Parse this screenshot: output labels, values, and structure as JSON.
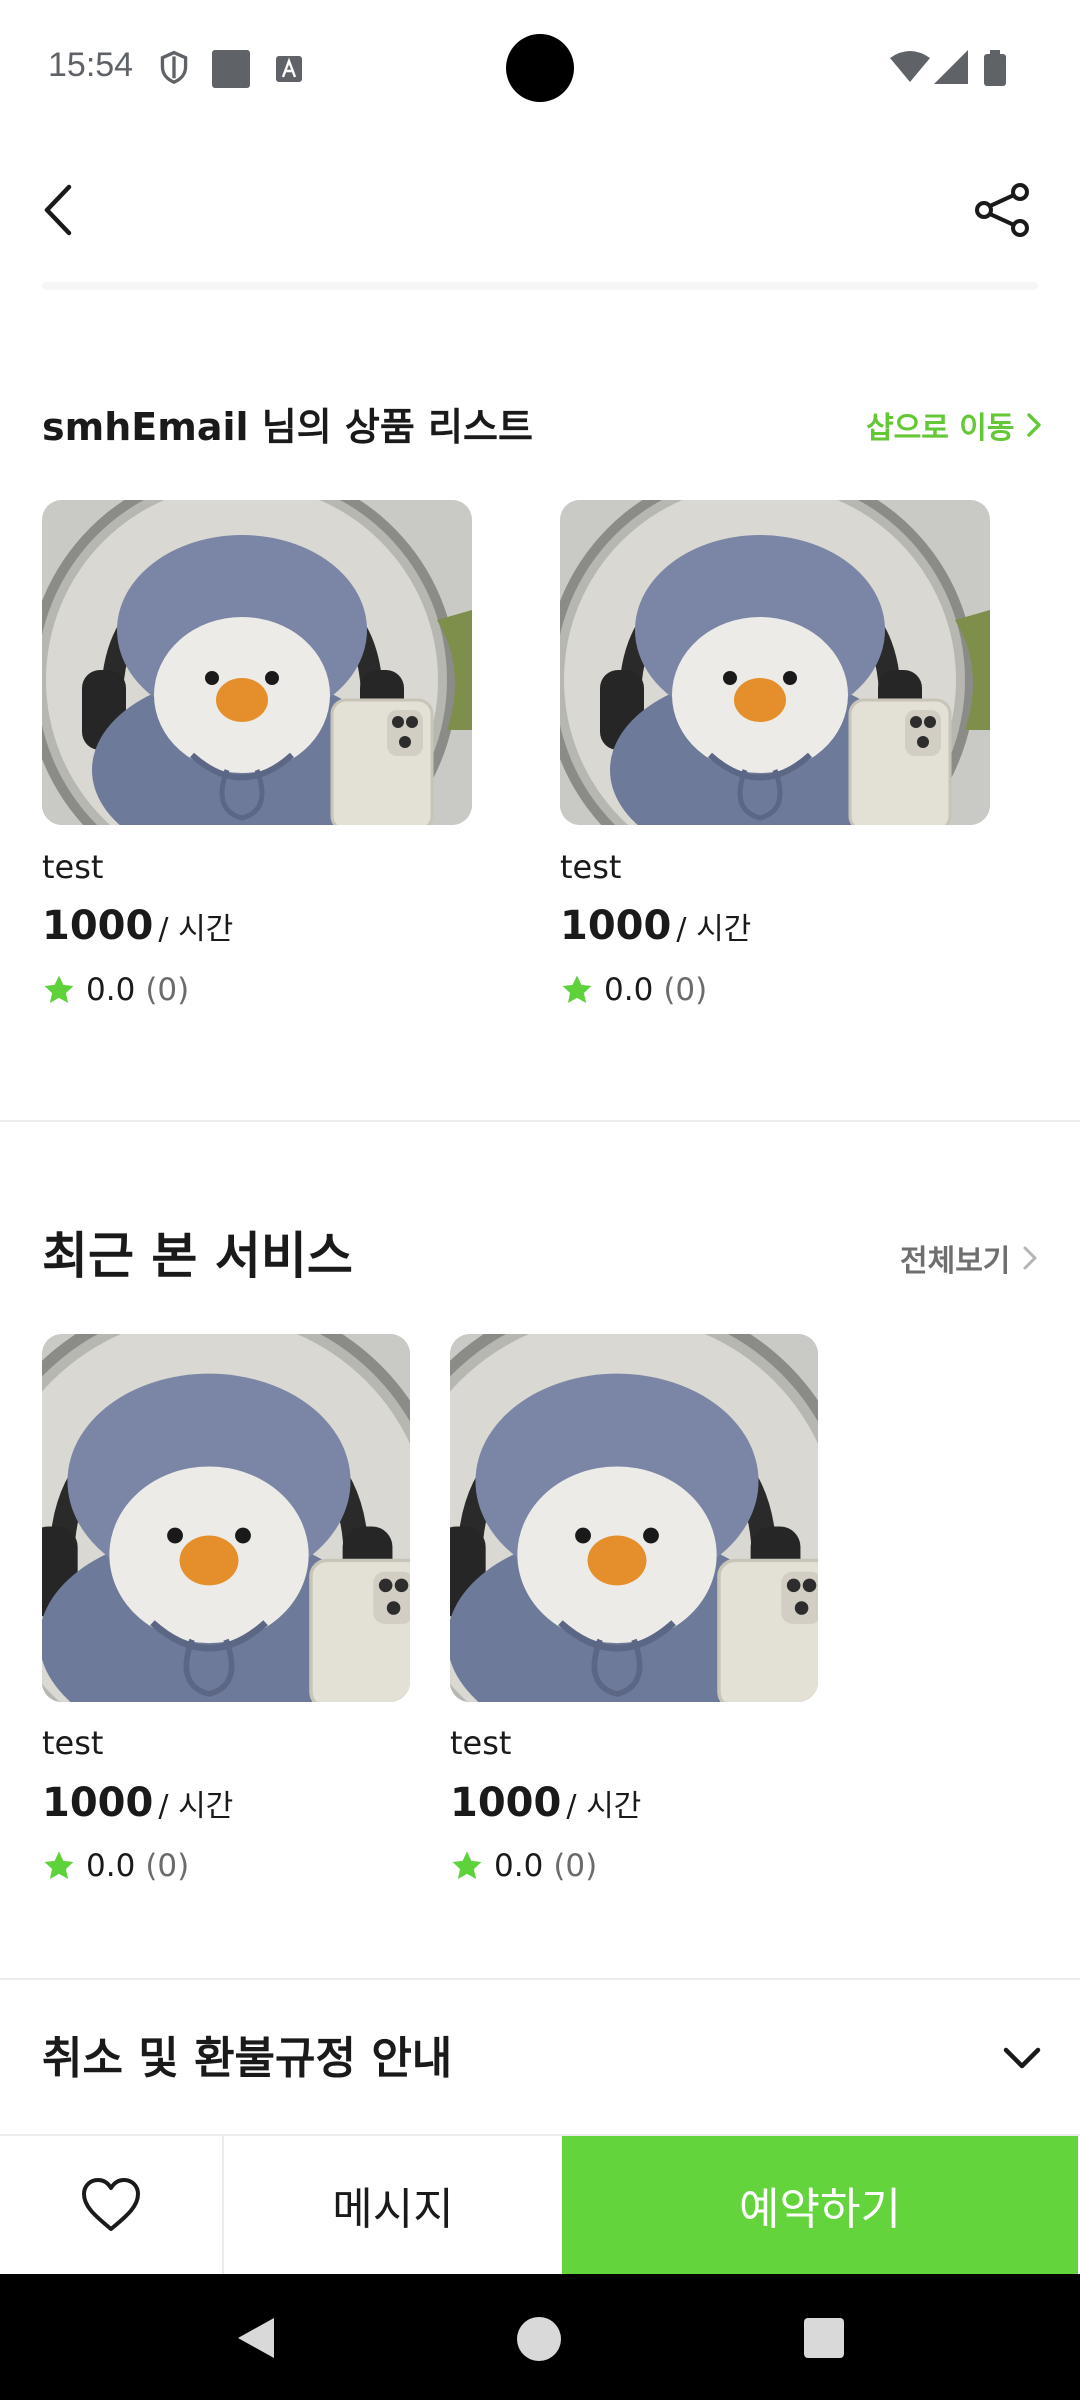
{
  "status_bar": {
    "time": "15:54"
  },
  "top_bar": {
    "back_icon": "chevron-left-icon",
    "share_icon": "share-icon"
  },
  "shop_section": {
    "title": "smhEmail 님의 상품 리스트",
    "link_label": "샵으로 이동",
    "accent_color": "#63c736",
    "products": [
      {
        "name": "test",
        "price": "1000",
        "unit": "/ 시간",
        "rating": "0.0",
        "review_count": "(0)"
      },
      {
        "name": "test",
        "price": "1000",
        "unit": "/ 시간",
        "rating": "0.0",
        "review_count": "(0)"
      }
    ]
  },
  "recent_section": {
    "title": "최근 본 서비스",
    "link_label": "전체보기",
    "products": [
      {
        "name": "test",
        "price": "1000",
        "unit": "/ 시간",
        "rating": "0.0",
        "review_count": "(0)"
      },
      {
        "name": "test",
        "price": "1000",
        "unit": "/ 시간",
        "rating": "0.0",
        "review_count": "(0)"
      }
    ]
  },
  "refund_section": {
    "title": "취소 및 환불규정 안내",
    "toggle_icon": "chevron-down-icon"
  },
  "action_bar": {
    "wishlist_icon": "heart-icon",
    "message_label": "메시지",
    "reserve_label": "예약하기",
    "reserve_color": "#63d43c"
  },
  "star_color": "#5ed23a"
}
